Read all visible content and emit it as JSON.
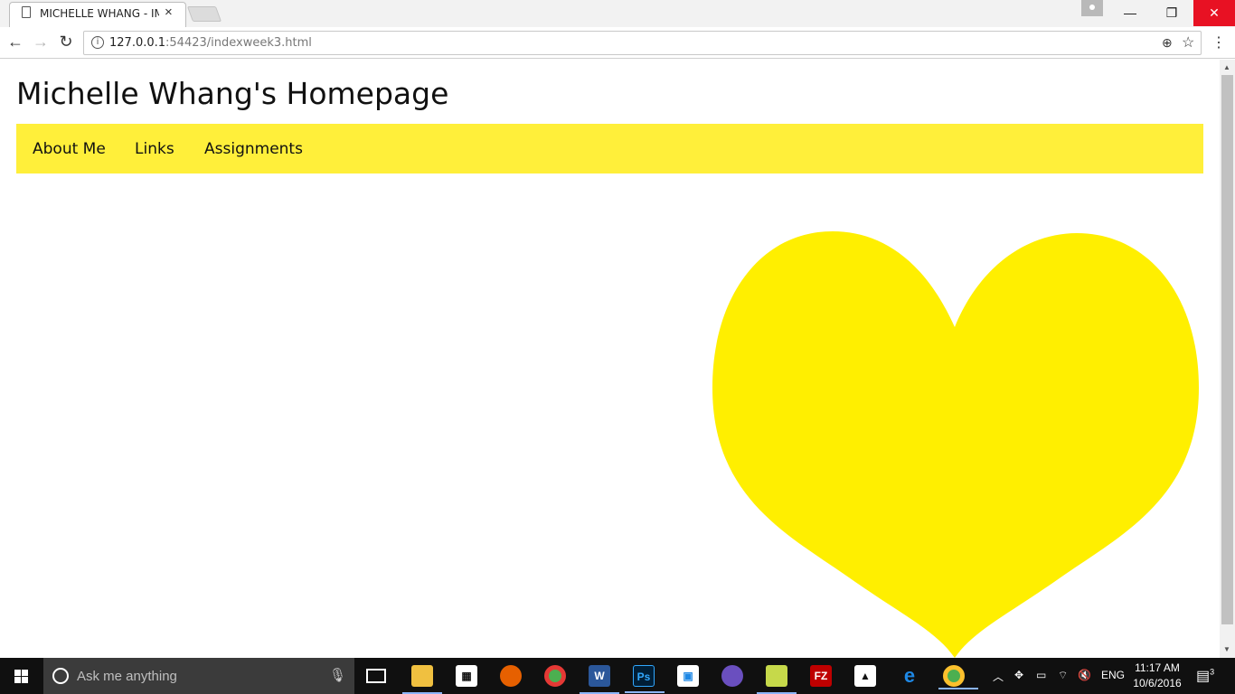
{
  "browser": {
    "tab_title": "MICHELLE WHANG - IML",
    "url_host": "127.0.0.1",
    "url_rest": ":54423/indexweek3.html"
  },
  "page": {
    "title": "Michelle Whang's Homepage",
    "nav": [
      {
        "label": "About Me"
      },
      {
        "label": "Links"
      },
      {
        "label": "Assignments"
      }
    ],
    "accent_color": "#ffef3a",
    "heart_color": "#ffef00"
  },
  "taskbar": {
    "search_placeholder": "Ask me anything",
    "apps": [
      "task-view",
      "file-explorer",
      "store",
      "firefox",
      "chrome",
      "word",
      "photoshop",
      "app-box",
      "cat-app",
      "notes",
      "filezilla",
      "photos",
      "edge",
      "chrome-active"
    ],
    "language": "ENG",
    "time": "11:17 AM",
    "date": "10/6/2016",
    "notification_count": "3"
  }
}
